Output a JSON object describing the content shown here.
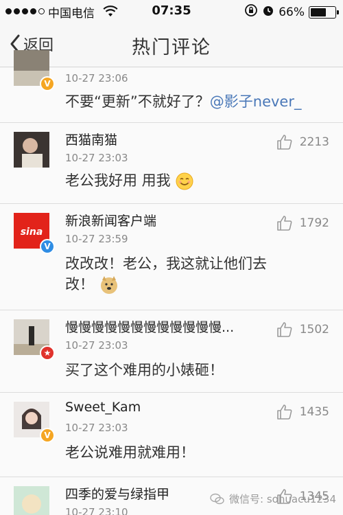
{
  "status": {
    "carrier": "中国电信",
    "time": "07:35",
    "battery": "66%",
    "battery_level": 0.66
  },
  "nav": {
    "back_label": "返回",
    "title": "热门评论"
  },
  "comments": [
    {
      "username": "",
      "time": "10-27 23:06",
      "text": "不要“更新”不就好了？",
      "mention": "@影子never_",
      "likes": ""
    },
    {
      "username": "西猫南猫",
      "time": "10-27 23:03",
      "text": "老公我好用  用我",
      "likes": "2213"
    },
    {
      "username": "新浪新闻客户端",
      "time": "10-27 23:59",
      "text": "改改改！老公，我这就让他们去改！",
      "likes": "1792"
    },
    {
      "username": "慢慢慢慢慢慢慢慢慢慢慢慢...",
      "time": "10-27 23:03",
      "text": "买了这个难用的小婊砸！",
      "likes": "1502"
    },
    {
      "username": "Sweet_Kam",
      "time": "10-27 23:03",
      "text": "老公说难用就难用！",
      "likes": "1435"
    },
    {
      "username": "四季的爱与绿指甲",
      "time": "10-27 23:10",
      "text": "",
      "likes": "1345"
    }
  ],
  "watermark": "微信号: sohuacu1234",
  "colors": {
    "mention": "#4a78b8",
    "verified_badge": "#f5a623",
    "red_badge": "#e0322c"
  }
}
